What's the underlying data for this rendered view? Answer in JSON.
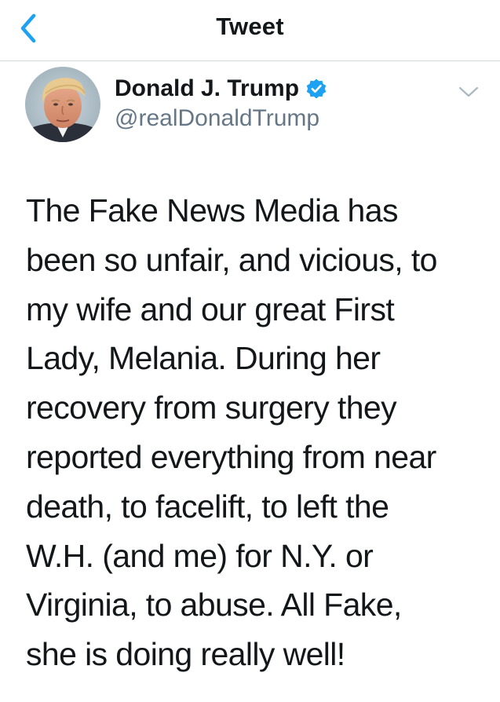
{
  "header": {
    "title": "Tweet",
    "back_icon": "chevron-left-icon",
    "accent_color": "#1da1f2"
  },
  "author": {
    "display_name": "Donald J. Trump",
    "handle": "@realDonaldTrump",
    "verified": true,
    "verified_icon": "verified-badge-icon",
    "menu_icon": "chevron-down-icon"
  },
  "tweet": {
    "lines": [
      "The Fake News Media has",
      "been so unfair, and vicious, to",
      "my wife and our great First",
      "Lady, Melania. During her",
      "recovery from surgery they",
      "reported everything from near",
      "death, to facelift, to left the",
      "W.H. (and me) for N.Y. or",
      "Virginia, to abuse. All Fake,",
      "she is doing really well!"
    ]
  }
}
